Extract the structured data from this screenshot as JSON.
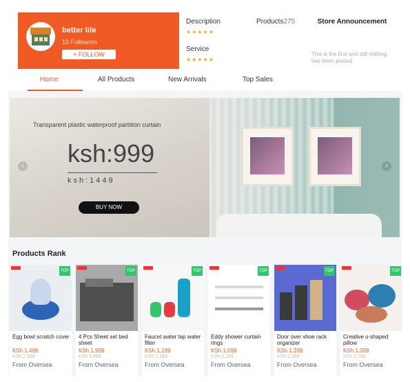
{
  "store": {
    "name": "better life",
    "followers": "10 Followers",
    "follow_label": "+ FOLLOW",
    "description_label": "Description",
    "service_label": "Service",
    "description_stars": "★★★★★",
    "service_stars": "★★★★★",
    "products_label": "Products",
    "products_count": "275",
    "announcement_title": "Store Announcement",
    "announcement_text": "This is the first and still nothing has been posted"
  },
  "tabs": [
    {
      "label": "Home",
      "active": true
    },
    {
      "label": "All Products",
      "active": false
    },
    {
      "label": "New Arrivals",
      "active": false
    },
    {
      "label": "Top Sales",
      "active": false
    }
  ],
  "banner": {
    "caption": "Transparent plastic waterproof partition curtain",
    "price": "ksh:999",
    "old_price": "ksh:1449",
    "button": "BUY NOW",
    "arrow_left": "‹",
    "arrow_right": "›"
  },
  "rank": {
    "title": "Products Rank",
    "products": [
      {
        "name": "Egg bowl scratch cover",
        "price": "KSh 1,499",
        "old": "KSh 2,999",
        "from": "From Oversea",
        "palette": [
          "#e9eef3",
          "#2e64b7",
          "#c8d7ea"
        ]
      },
      {
        "name": "4 Pcs Sheet set bed sheet",
        "price": "KSh 1,999",
        "old": "KSh 3,499",
        "from": "From Oversea",
        "palette": [
          "#4f4f52",
          "#737377",
          "#a8a8ab"
        ]
      },
      {
        "name": "Faucet water tap water filter",
        "price": "KSh 1,199",
        "old": "KSh 2,399",
        "from": "From Oversea",
        "palette": [
          "#f7f7f7",
          "#1aa0c9",
          "#e43d3d"
        ]
      },
      {
        "name": "Eddy shower curtain rings",
        "price": "KSh 1,099",
        "old": "KSh 2,199",
        "from": "From Oversea",
        "palette": [
          "#ffffff",
          "#d8d8d8",
          "#9a9a9a"
        ]
      },
      {
        "name": "Door over shoe rack organizer",
        "price": "KSh 1,299",
        "old": "KSh 2,599",
        "from": "From Oversea",
        "palette": [
          "#5b6ad1",
          "#3a3a3a",
          "#d2b38a"
        ]
      },
      {
        "name": "Creative u-shaped pillow",
        "price": "KSh 1,399",
        "old": "KSh 2,799",
        "from": "From Oversea",
        "palette": [
          "#d24b5e",
          "#2f7fb0",
          "#c77c59"
        ]
      }
    ],
    "badge_label": "TOP"
  },
  "colors": {
    "accent": "#f05a24",
    "badge": "#35c46d"
  }
}
